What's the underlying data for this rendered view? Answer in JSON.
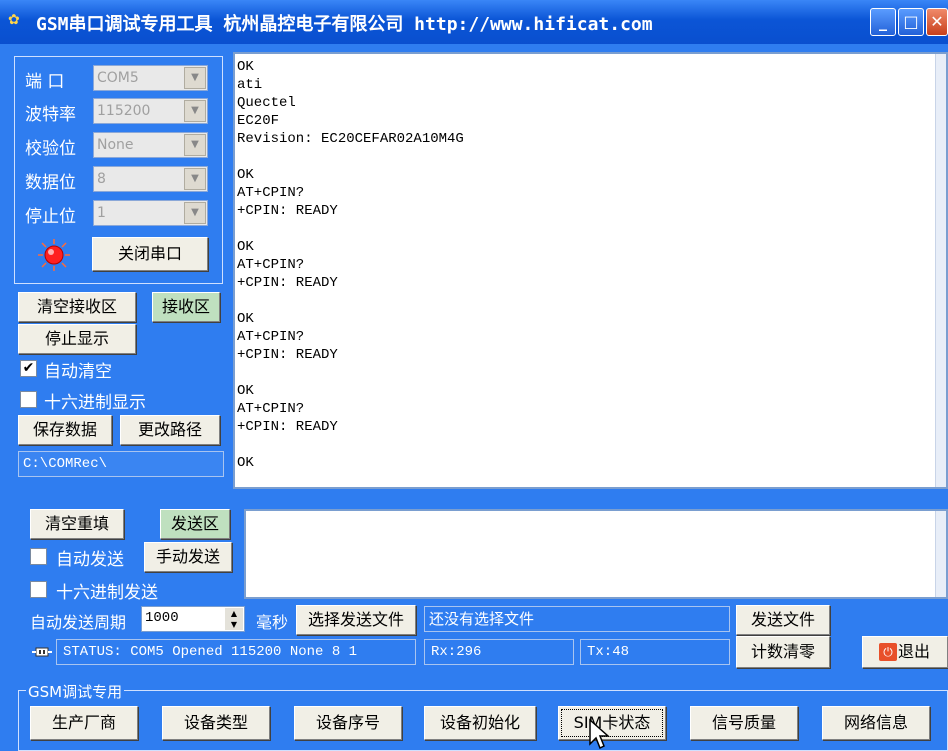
{
  "window": {
    "title": "GSM串口调试专用工具 杭州晶控电子有限公司 http://www.hificat.com",
    "min": "_",
    "max": "□",
    "close": "✕"
  },
  "serial": {
    "port_label": "端  口",
    "port_value": "COM5",
    "baud_label": "波特率",
    "baud_value": "115200",
    "parity_label": "校验位",
    "parity_value": "None",
    "databits_label": "数据位",
    "databits_value": "8",
    "stopbits_label": "停止位",
    "stopbits_value": "1",
    "close_port": "关闭串口",
    "led_color": "#ff2020"
  },
  "receive": {
    "clear": "清空接收区",
    "area_tag": "接收区",
    "stop_display": "停止显示",
    "auto_clear": "自动清空",
    "auto_clear_checked": "✔",
    "hex_display": "十六进制显示",
    "hex_display_checked": "",
    "save": "保存数据",
    "change_path": "更改路径",
    "path": "C:\\COMRec\\",
    "lines": [
      "OK",
      "ati",
      "Quectel",
      "EC20F",
      "Revision: EC20CEFAR02A10M4G",
      "",
      "OK",
      "AT+CPIN?",
      "+CPIN: READY",
      "",
      "OK",
      "AT+CPIN?",
      "+CPIN: READY",
      "",
      "OK",
      "AT+CPIN?",
      "+CPIN: READY",
      "",
      "OK",
      "AT+CPIN?",
      "+CPIN: READY",
      "",
      "OK"
    ]
  },
  "send": {
    "clear": "清空重填",
    "area_tag": "发送区",
    "auto_send": "自动发送",
    "auto_send_checked": "",
    "manual_send": "手动发送",
    "hex_send": "十六进制发送",
    "hex_send_checked": "",
    "period_label": "自动发送周期",
    "period_value": "1000",
    "period_unit": "毫秒",
    "select_file": "选择发送文件",
    "file_status": "还没有选择文件",
    "send_file": "发送文件"
  },
  "status": {
    "text": "STATUS: COM5 Opened 115200 None 8 1",
    "rx": "Rx:296",
    "tx": "Tx:48",
    "reset_count": "计数清零",
    "exit": "退出"
  },
  "gsm": {
    "group_title": "GSM调试专用",
    "buttons": [
      "生产厂商",
      "设备类型",
      "设备序号",
      "设备初始化",
      "SIM卡状态",
      "信号质量",
      "网络信息"
    ]
  }
}
